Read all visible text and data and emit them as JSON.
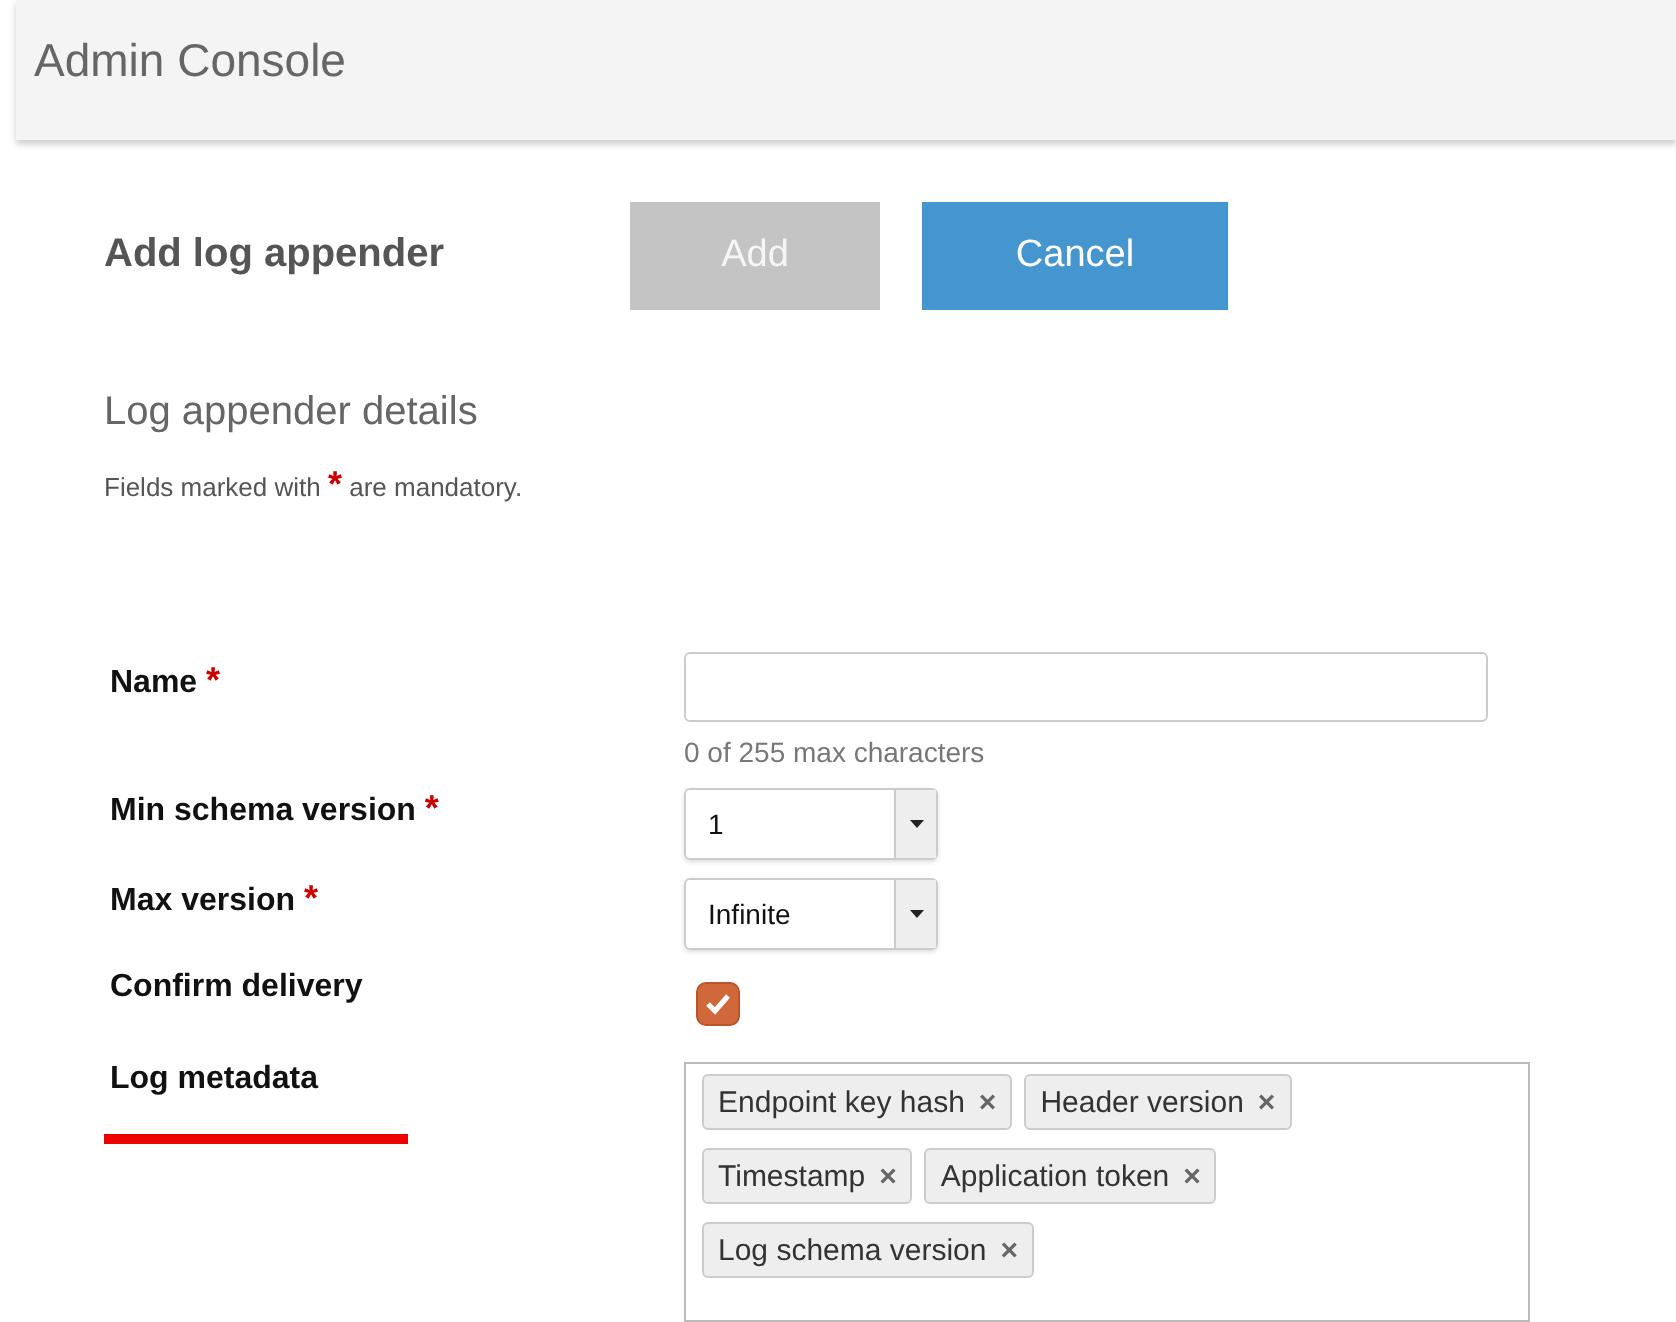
{
  "header": {
    "title": "Admin Console"
  },
  "page": {
    "title": "Add log appender",
    "buttons": [
      {
        "label": "Add",
        "kind": "primary",
        "disabled": true
      },
      {
        "label": "Cancel",
        "kind": "secondary",
        "disabled": false
      }
    ]
  },
  "section": {
    "title": "Log appender details",
    "note": {
      "before": "Fields marked with",
      "mark": "*",
      "after": "are mandatory."
    }
  },
  "fields": [
    {
      "kind": "text",
      "label": "Name",
      "required_mark": "*",
      "hint": "0 of 255 max characters"
    },
    {
      "kind": "select",
      "label": "Min schema version",
      "required_mark": "*",
      "value": "1"
    },
    {
      "kind": "select",
      "label": "Max version",
      "required_mark": "*",
      "value": "Infinite"
    },
    {
      "kind": "checkbox",
      "label": "Confirm delivery",
      "checked": true
    },
    {
      "kind": "tags",
      "label": "Log metadata",
      "underlined": true,
      "remove_glyph": "×",
      "tags": [
        "Endpoint key hash",
        "Header version",
        "Timestamp",
        "Application token",
        "Log schema version"
      ]
    }
  ]
}
